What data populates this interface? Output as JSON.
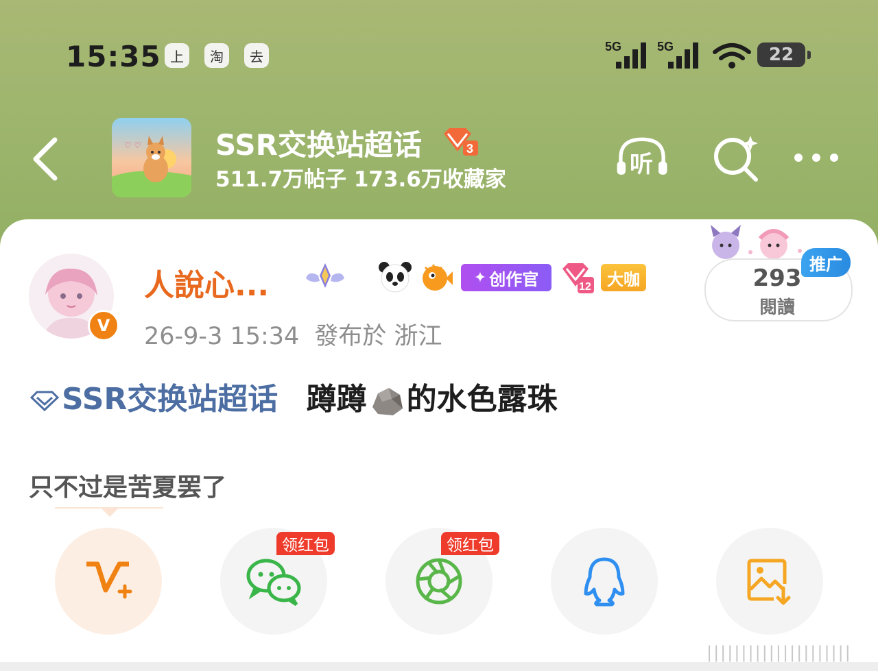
{
  "status_bar": {
    "time": "15:35",
    "mini_icons": [
      "上",
      "淘",
      "去"
    ],
    "network_1": "5G",
    "network_2": "5G",
    "battery": "22"
  },
  "header": {
    "topic_title": "SSR交换站超话",
    "topic_level": "3",
    "topic_stats": "511.7万帖子 173.6万收藏家",
    "listen_label": "听"
  },
  "post": {
    "username": "人說心...",
    "creator_badge": "创作官",
    "supertopic_level": "12",
    "bigshot_badge": "大咖",
    "timestamp": "26-9-3 15:34",
    "location_text": "發布於 浙江",
    "read_count": "293",
    "read_label": "閱讀",
    "promo_label": "推广",
    "topic_link": "SSR交换站超话",
    "text_part1": "蹲蹲",
    "text_part2": "的水色露珠",
    "subtext": "只不过是苦夏罢了"
  },
  "share": {
    "redpacket_label_1": "领红包",
    "redpacket_label_2": "领红包",
    "buttons": [
      "v-plus-icon",
      "wechat-icon",
      "moments-icon",
      "qq-icon",
      "save-image-icon"
    ]
  },
  "watermark": "|||||||||||||||||||||"
}
